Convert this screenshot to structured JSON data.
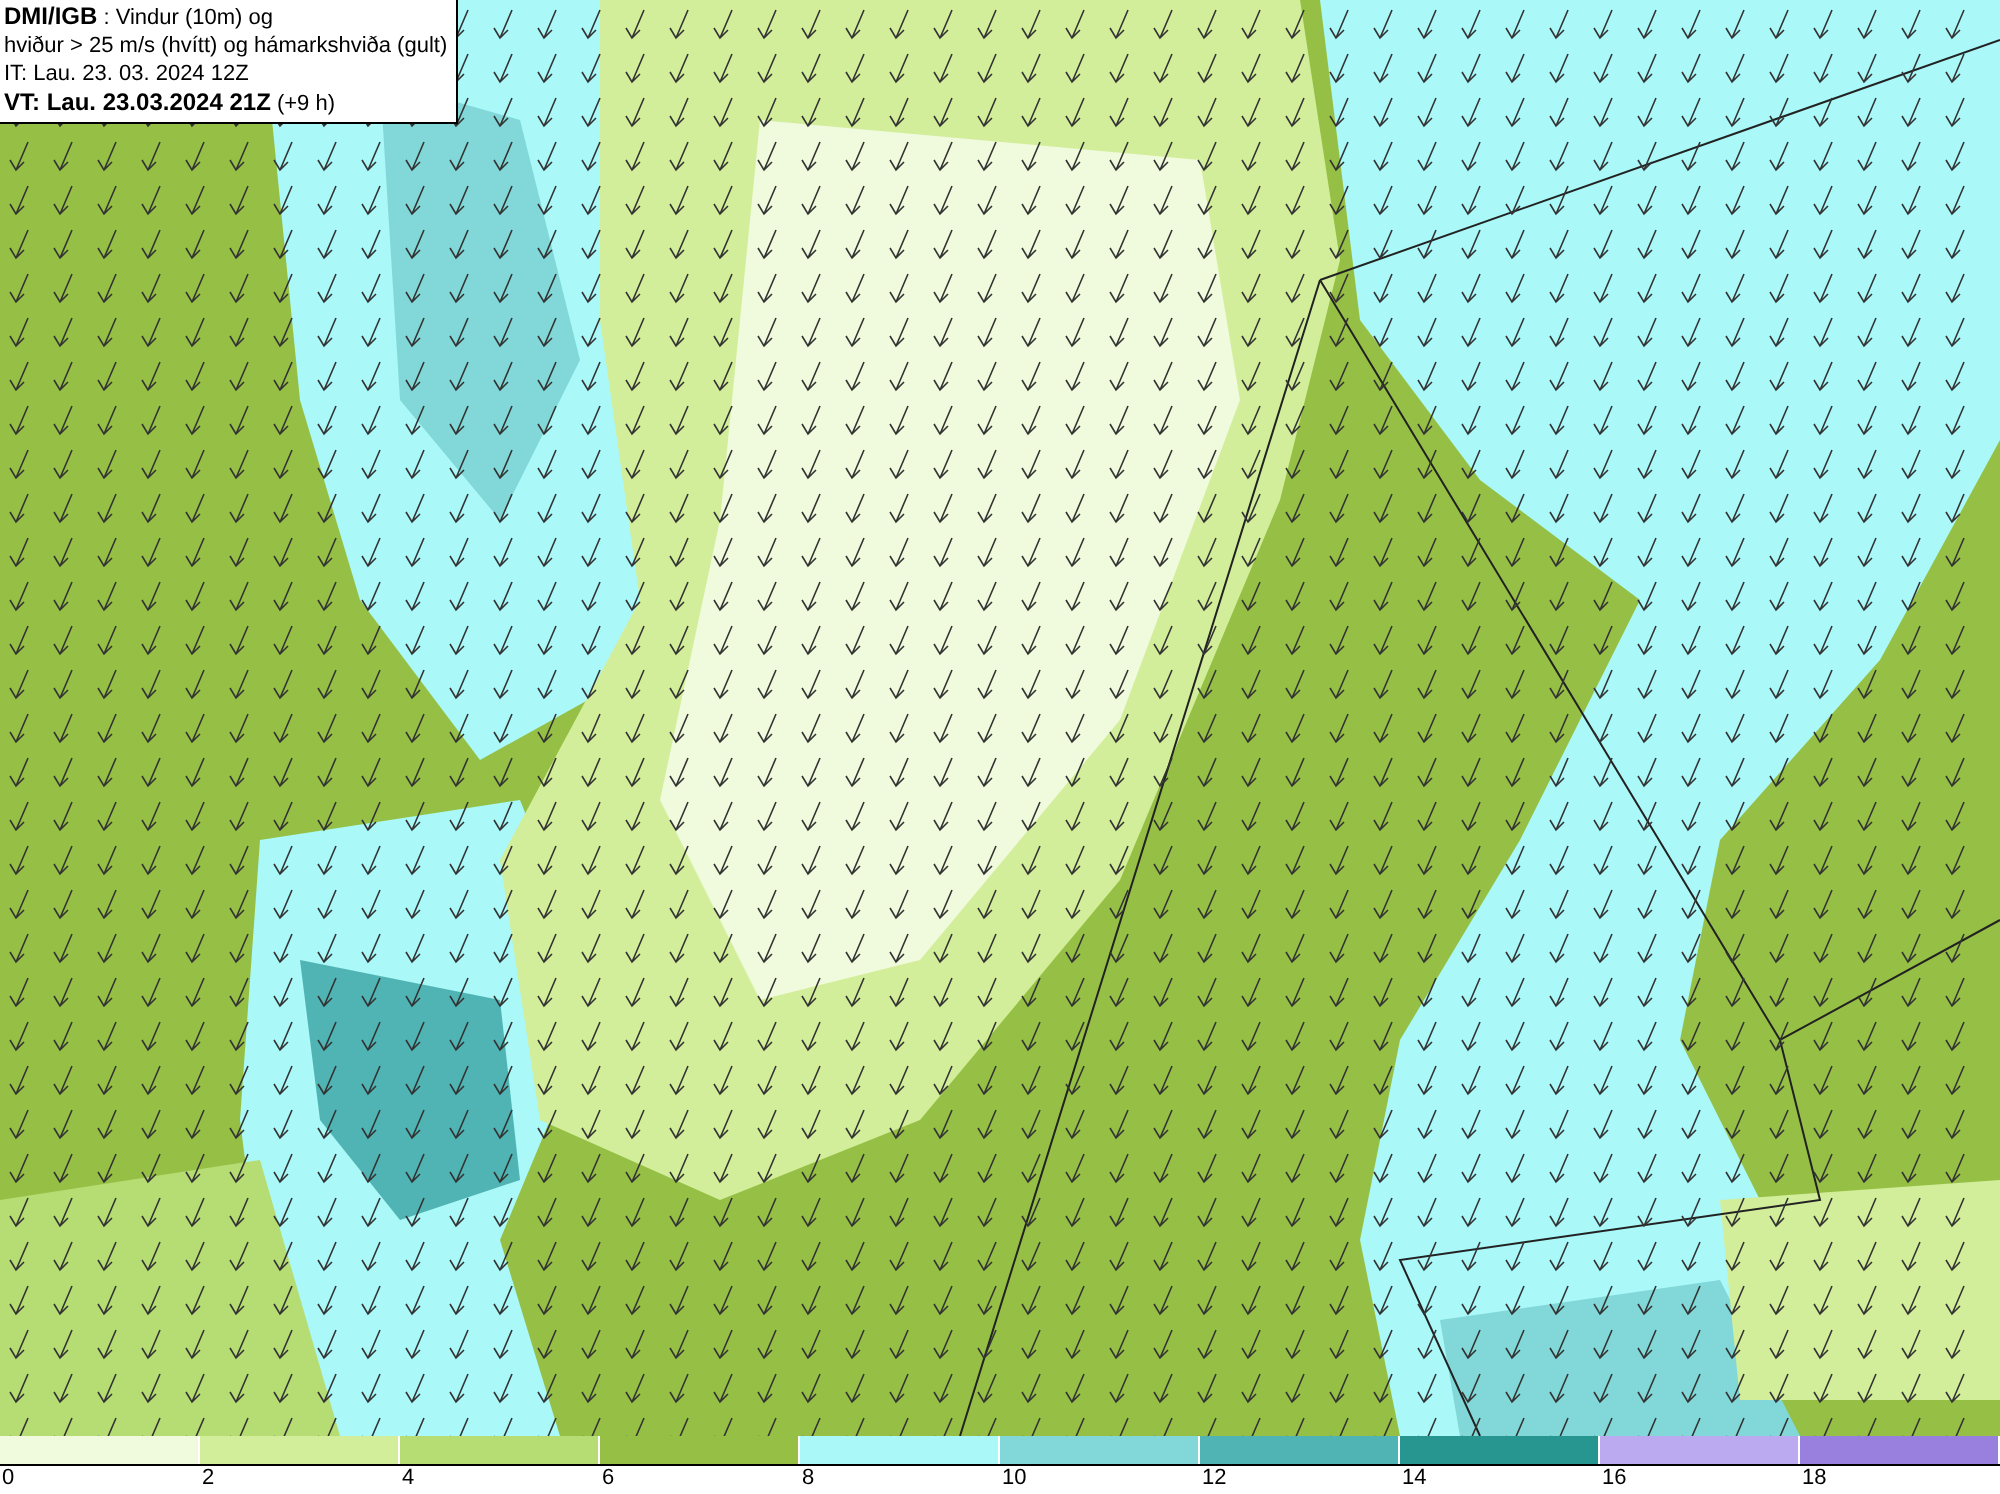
{
  "header": {
    "lines": [
      "**DMI/IGB** : Vindur (10m) og",
      "hviður > 25 m/s (hvítt) og hámarkshviða (gult)",
      "IT: Lau. 23. 03. 2024 12Z",
      "**VT: Lau. 23.03.2024 21Z** (+9 h)"
    ]
  },
  "legend": {
    "bins": [
      {
        "color": "#f0fadc"
      },
      {
        "color": "#d2ee9a"
      },
      {
        "color": "#b6dc74"
      },
      {
        "color": "#96c045"
      },
      {
        "color": "#aaf8f8"
      },
      {
        "color": "#82d8d8"
      },
      {
        "color": "#50b4b4"
      },
      {
        "color": "#289690"
      },
      {
        "color": "#bcaaf0"
      },
      {
        "color": "#9a80de"
      }
    ],
    "ticks": [
      "0",
      "2",
      "4",
      "6",
      "8",
      "10",
      "12",
      "14",
      "16",
      "18"
    ]
  }
}
